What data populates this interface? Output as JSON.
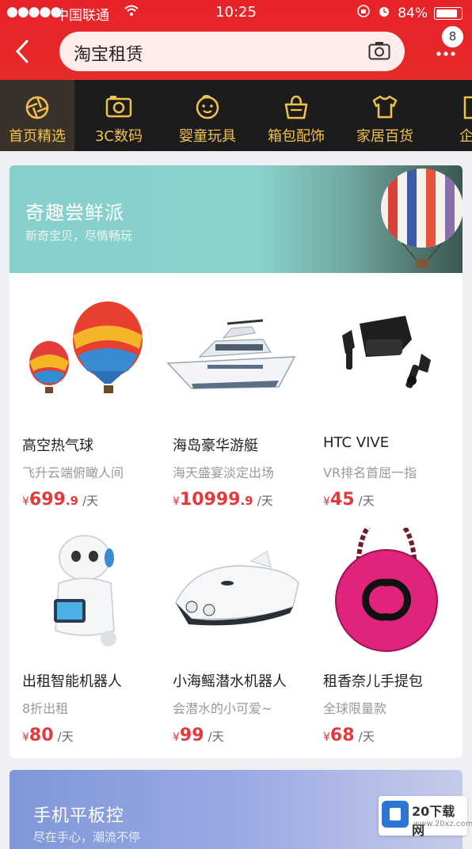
{
  "status_bar": {
    "signal_dots": "●●●●●",
    "carrier": "中国联通",
    "time": "10:25",
    "battery": "84%",
    "battery_level": 0.84
  },
  "header": {
    "search_text": "淘宝租赁",
    "badge_count": "8"
  },
  "categories": [
    {
      "label": "首页精选",
      "icon": "aperture-icon"
    },
    {
      "label": "3C数码",
      "icon": "camera-icon"
    },
    {
      "label": "婴童玩具",
      "icon": "baby-face-icon"
    },
    {
      "label": "箱包配饰",
      "icon": "handbag-icon"
    },
    {
      "label": "家居百货",
      "icon": "tshirt-icon"
    },
    {
      "label": "企业",
      "icon": "building-icon"
    }
  ],
  "banner": {
    "title": "奇趣尝鲜派",
    "subtitle": "新奇宝贝，尽情畅玩"
  },
  "products": [
    {
      "name": "高空热气球",
      "desc": "飞升云端俯瞰人间",
      "currency": "¥",
      "price_int": "699",
      "price_dec": ".9",
      "unit": "/天"
    },
    {
      "name": "海岛豪华游艇",
      "desc": "海天盛宴淡定出场",
      "currency": "¥",
      "price_int": "10999",
      "price_dec": ".9",
      "unit": "/天"
    },
    {
      "name": "HTC VIVE",
      "desc": "VR排名首屈一指",
      "currency": "¥",
      "price_int": "45",
      "price_dec": "",
      "unit": "/天"
    },
    {
      "name": "出租智能机器人",
      "desc": "8折出租",
      "currency": "¥",
      "price_int": "80",
      "price_dec": "",
      "unit": "/天"
    },
    {
      "name": "小海鳐潜水机器人",
      "desc": "会潜水的小可爱~",
      "currency": "¥",
      "price_int": "99",
      "price_dec": "",
      "unit": "/天"
    },
    {
      "name": "租香奈儿手提包",
      "desc": "全球限量款",
      "currency": "¥",
      "price_int": "68",
      "price_dec": "",
      "unit": "/天"
    }
  ],
  "banner2": {
    "title": "手机平板控",
    "subtitle": "尽在手心，潮流不停"
  },
  "watermark": {
    "text": "20下载网",
    "url": "www.20xz.com"
  },
  "colors": {
    "header_red": "#e52a2a",
    "category_bg": "#1c1c1c",
    "category_gold": "#f0c24d",
    "price_red": "#e4393c"
  }
}
